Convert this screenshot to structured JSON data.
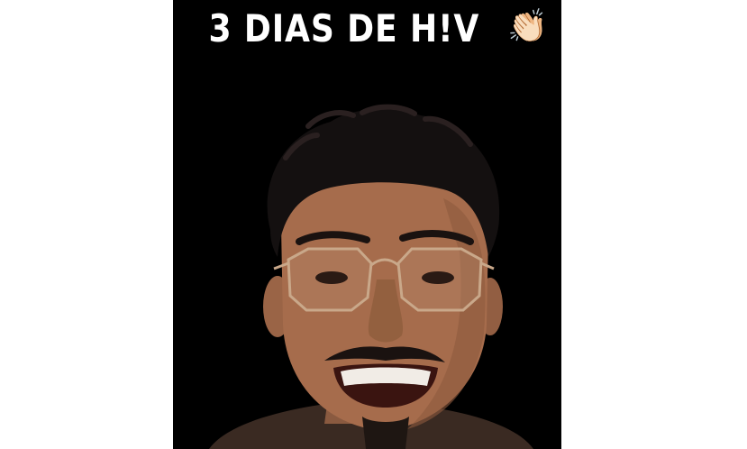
{
  "video": {
    "caption_text": "3 DIAS DE H!V",
    "caption_emoji": "👏🏻",
    "caption_emoji_name": "clapping-hands-icon",
    "background_color": "#000000",
    "caption_color": "#ffffff",
    "page_background": "#ffffff"
  }
}
